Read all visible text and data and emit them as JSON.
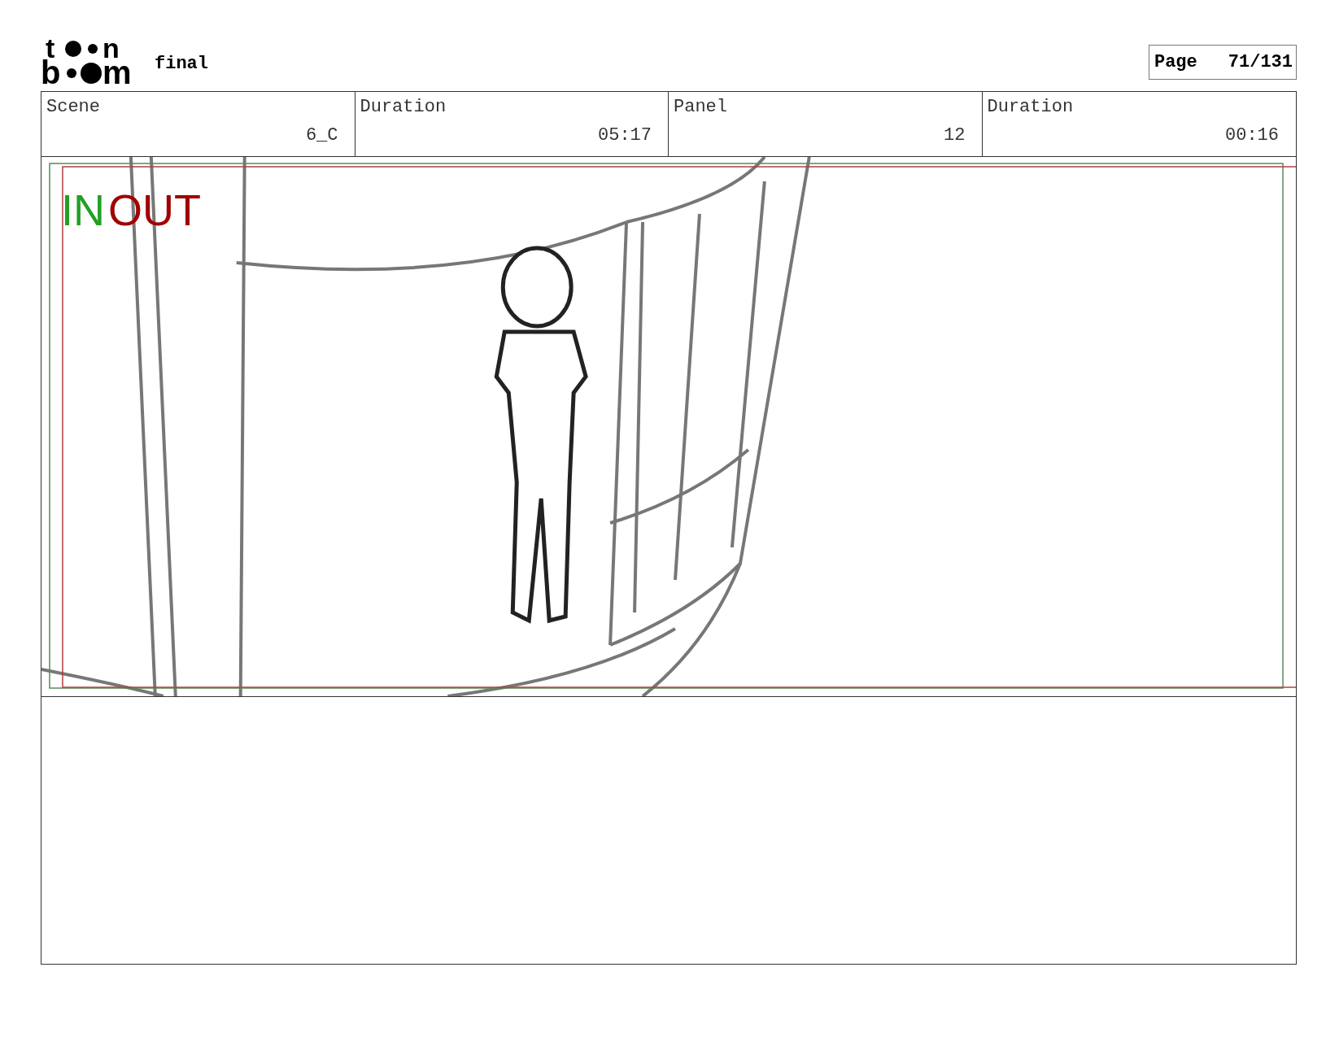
{
  "logo": {
    "lines": [
      [
        "t",
        "n"
      ],
      [
        "b",
        "m"
      ]
    ]
  },
  "project": "final",
  "page": {
    "label": "Page",
    "value": "71/131"
  },
  "fields": [
    {
      "label": "Scene",
      "value": "6_C"
    },
    {
      "label": "Duration",
      "value": "05:17"
    },
    {
      "label": "Panel",
      "value": "12"
    },
    {
      "label": "Duration",
      "value": "00:16"
    }
  ],
  "panel": {
    "markers": [
      {
        "text": "IN",
        "color": "#22a022"
      },
      {
        "text": "OUT",
        "color": "#a00000"
      }
    ]
  }
}
